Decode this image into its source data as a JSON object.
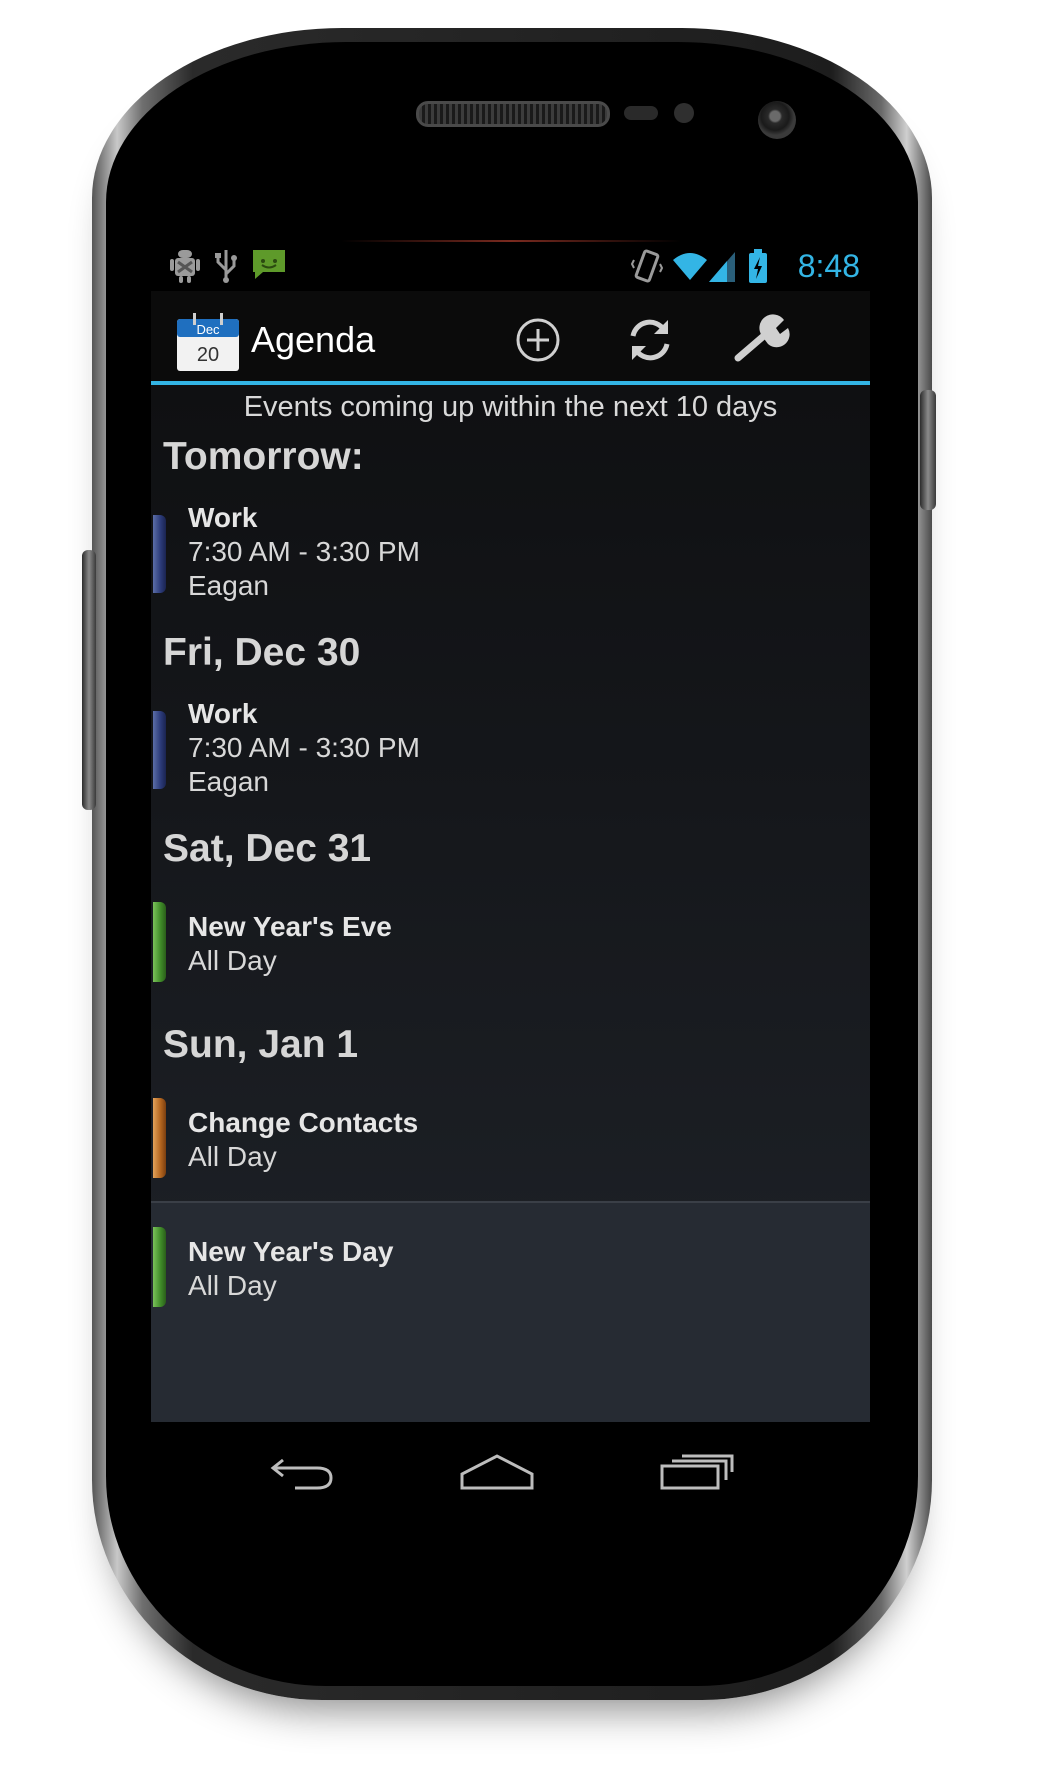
{
  "status_bar": {
    "time": "8:48",
    "left_icons": [
      "android-debug-icon",
      "usb-icon",
      "message-icon"
    ],
    "right_icons": [
      "vibrate-icon",
      "wifi-icon",
      "signal-icon",
      "battery-charging-icon"
    ]
  },
  "action_bar": {
    "app_icon": {
      "month": "Dec",
      "day": "20"
    },
    "title": "Agenda",
    "actions": [
      "add-icon",
      "refresh-icon",
      "settings-wrench-icon"
    ]
  },
  "agenda": {
    "subtitle": "Events coming up within the next 10 days",
    "days": [
      {
        "header": "Tomorrow:",
        "events": [
          {
            "title": "Work",
            "time": "7:30 AM - 3:30 PM",
            "location": "Eagan",
            "color": "#2b3a78"
          }
        ]
      },
      {
        "header": "Fri, Dec 30",
        "events": [
          {
            "title": "Work",
            "time": "7:30 AM - 3:30 PM",
            "location": "Eagan",
            "color": "#2b3a78"
          }
        ]
      },
      {
        "header": "Sat, Dec 31",
        "events": [
          {
            "title": "New Year's Eve",
            "time": "All Day",
            "color": "#3f8a28"
          }
        ]
      },
      {
        "header": "Sun, Jan 1",
        "events": [
          {
            "title": "Change Contacts",
            "time": "All Day",
            "color": "#b2641e"
          },
          {
            "title": "New Year's Day",
            "time": "All Day",
            "color": "#3f8a28"
          }
        ]
      }
    ]
  },
  "nav_bar": {
    "buttons": [
      "back-icon",
      "home-icon",
      "recent-apps-icon"
    ]
  },
  "colors": {
    "accent": "#33b5e5",
    "background": "#15171b"
  }
}
